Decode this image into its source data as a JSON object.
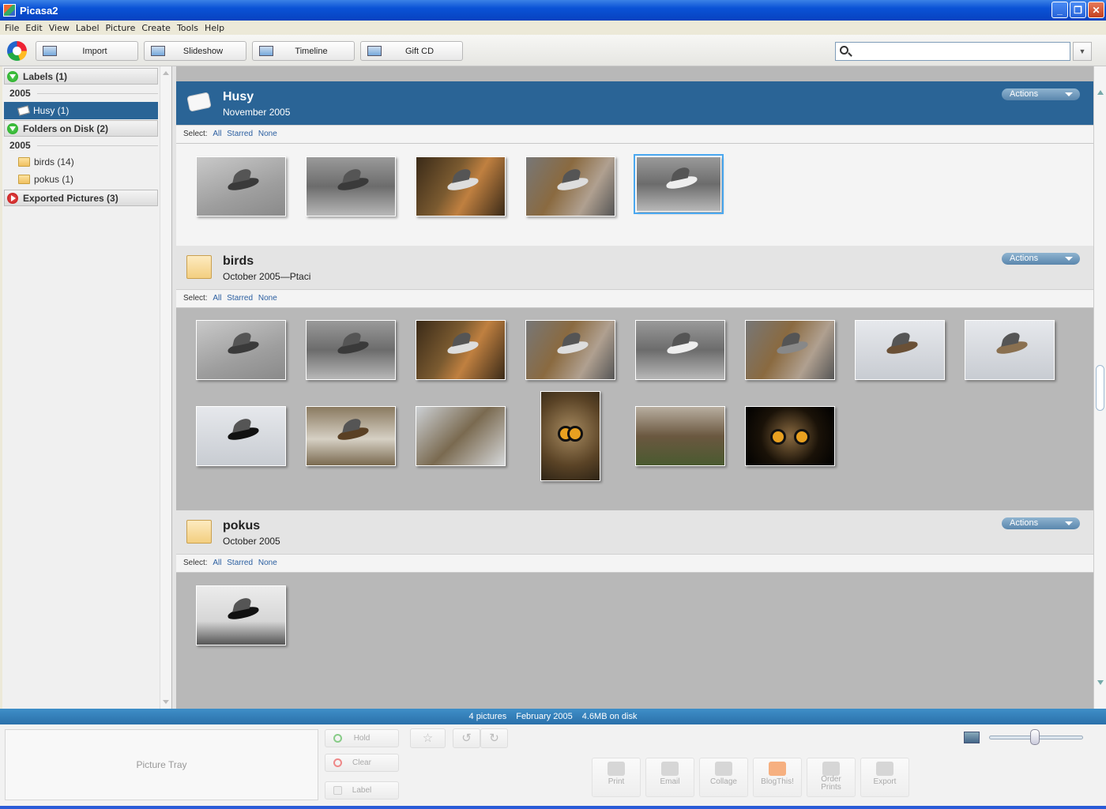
{
  "window": {
    "title": "Picasa2"
  },
  "menu": [
    "File",
    "Edit",
    "View",
    "Label",
    "Picture",
    "Create",
    "Tools",
    "Help"
  ],
  "toolbar": {
    "import": "Import",
    "slideshow": "Slideshow",
    "timeline": "Timeline",
    "giftcd": "Gift CD"
  },
  "search": {
    "value": "",
    "placeholder": ""
  },
  "left": {
    "labels_header": "Labels (1)",
    "labels_year": "2005",
    "labels_items": [
      {
        "label": "Husy (1)"
      }
    ],
    "folders_header": "Folders on Disk (2)",
    "folders_year": "2005",
    "folders_items": [
      {
        "label": "birds (14)"
      },
      {
        "label": "pokus (1)"
      }
    ],
    "exported_header": "Exported Pictures (3)"
  },
  "albums": [
    {
      "name": "Husy",
      "date": "November 2005",
      "actions": "Actions",
      "select": "Select:",
      "all": "All",
      "starred": "Starred",
      "none": "None"
    },
    {
      "name": "birds",
      "date": "October 2005—Ptaci",
      "actions": "Actions",
      "select": "Select:",
      "all": "All",
      "starred": "Starred",
      "none": "None"
    },
    {
      "name": "pokus",
      "date": "October 2005",
      "actions": "Actions",
      "select": "Select:",
      "all": "All",
      "starred": "Starred",
      "none": "None"
    }
  ],
  "status": {
    "pictures": "4 pictures",
    "date": "February 2005",
    "size": "4.6MB on disk"
  },
  "tray": {
    "label": "Picture Tray",
    "hold": "Hold",
    "clear": "Clear",
    "labelbtn": "Label",
    "actions": [
      {
        "label": "Print"
      },
      {
        "label": "Email"
      },
      {
        "label": "Collage"
      },
      {
        "label": "BlogThis!"
      },
      {
        "label": "Order Prints"
      },
      {
        "label": "Export"
      }
    ]
  }
}
